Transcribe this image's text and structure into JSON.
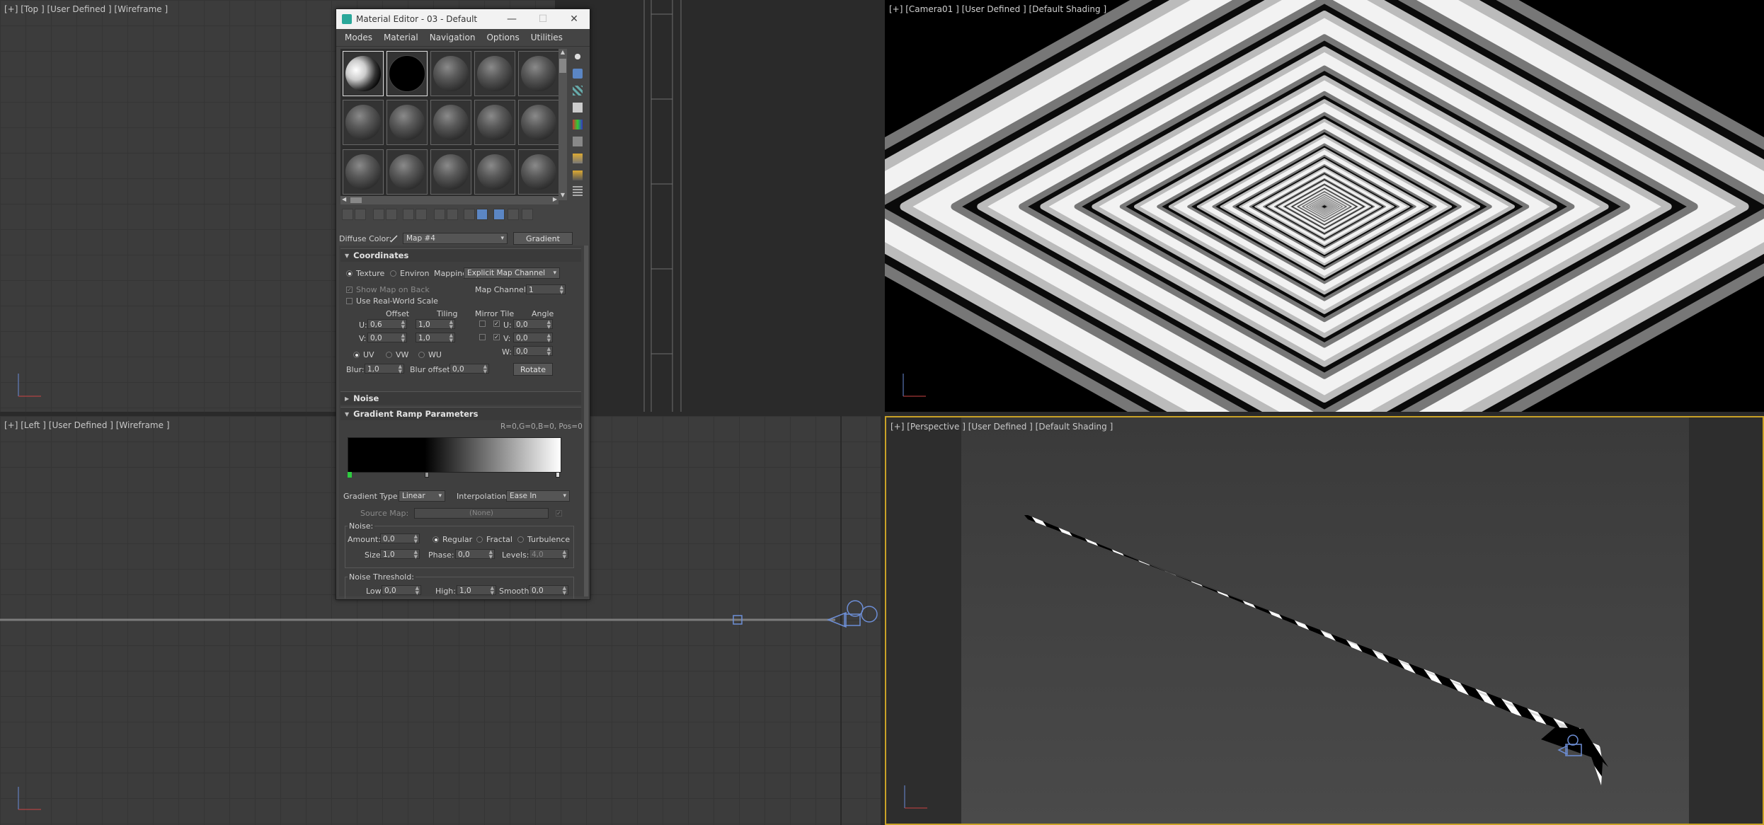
{
  "viewports": {
    "top": {
      "label": "[+] [Top ] [User Defined ] [Wireframe ]"
    },
    "camera": {
      "label": "[+] [Camera01 ] [User Defined ] [Default Shading ]"
    },
    "left": {
      "label": "[+] [Left ] [User Defined ] [Wireframe ]"
    },
    "perspective": {
      "label": "[+] [Perspective ] [User Defined ] [Default Shading ]"
    }
  },
  "material_editor": {
    "title": "Material Editor - 03 - Default",
    "menu": [
      "Modes",
      "Material",
      "Navigation",
      "Options",
      "Utilities"
    ],
    "diffuse_label": "Diffuse Color:",
    "map_name": "Map #4",
    "map_type": "Gradient Ramp",
    "coordinates": {
      "title": "Coordinates",
      "texture": "Texture",
      "environ": "Environ",
      "mapping_label": "Mapping:",
      "mapping_value": "Explicit Map Channel",
      "show_map_on_back": "Show Map on Back",
      "map_channel_label": "Map Channel:",
      "map_channel_value": "1",
      "use_real_world": "Use Real-World Scale",
      "offset": "Offset",
      "tiling": "Tiling",
      "mirror_tile": "Mirror Tile",
      "angle": "Angle",
      "u_label": "U:",
      "v_label": "V:",
      "w_label": "W:",
      "u_offset": "0,6",
      "v_offset": "0,0",
      "u_tiling": "1,0",
      "v_tiling": "1,0",
      "u_angle": "0,0",
      "v_angle": "0,0",
      "w_angle": "0,0",
      "uv": "UV",
      "vw": "VW",
      "wu": "WU",
      "blur_label": "Blur:",
      "blur_value": "1,0",
      "blur_offset_label": "Blur offset:",
      "blur_offset_value": "0,0",
      "rotate": "Rotate"
    },
    "noise_rollout": "Noise",
    "gradient_ramp": {
      "title": "Gradient Ramp Parameters",
      "readout": "R=0,G=0,B=0, Pos=0",
      "gradient_type_label": "Gradient Type:",
      "gradient_type_value": "Linear",
      "interpolation_label": "Interpolation:",
      "interpolation_value": "Ease In",
      "source_map_label": "Source Map:",
      "source_map_value": "(None)",
      "noise_label": "Noise:",
      "amount_label": "Amount:",
      "amount_value": "0,0",
      "regular": "Regular",
      "fractal": "Fractal",
      "turbulence": "Turbulence",
      "size_label": "Size:",
      "size_value": "1,0",
      "phase_label": "Phase:",
      "phase_value": "0,0",
      "levels_label": "Levels:",
      "levels_value": "4,0",
      "noise_threshold_label": "Noise Threshold:",
      "low_label": "Low:",
      "low_value": "0,0",
      "high_label": "High:",
      "high_value": "1,0",
      "smooth_label": "Smooth:",
      "smooth_value": "0,0"
    }
  },
  "colors": {
    "accent": "#5b86c4",
    "viewport_bg": "#3c3c3c",
    "active_border": "#c9a227"
  }
}
